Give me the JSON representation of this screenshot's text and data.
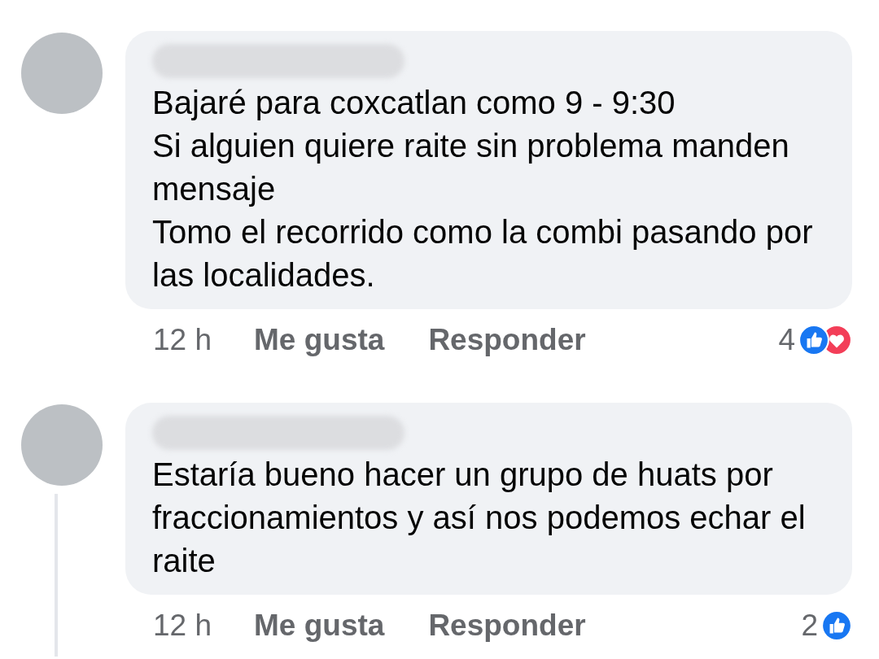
{
  "comments": [
    {
      "lines": [
        "Bajaré para coxcatlan como 9 - 9:30",
        "Si alguien quiere raite sin problema manden mensaje",
        "Tomo el recorrido como la combi pasando por las localidades."
      ],
      "time": "12 h",
      "like": "Me gusta",
      "reply": "Responder",
      "reaction_count": "4",
      "reactions": [
        {
          "kind": "like"
        },
        {
          "kind": "love"
        }
      ],
      "has_thread": false
    },
    {
      "lines": [
        "Estaría bueno hacer un grupo de huats por fraccionamientos y así nos podemos echar el raite"
      ],
      "time": "12 h",
      "like": "Me gusta",
      "reply": "Responder",
      "reaction_count": "2",
      "reactions": [
        {
          "kind": "like"
        }
      ],
      "has_thread": true
    }
  ]
}
